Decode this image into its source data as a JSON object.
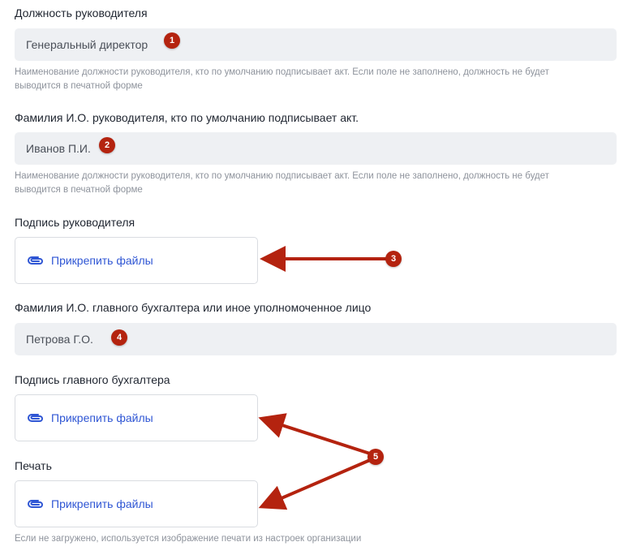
{
  "colors": {
    "annotation": "#b4230f",
    "link": "#2f56d4",
    "field_bg": "#eef0f3",
    "hint": "#8e939c"
  },
  "fields": {
    "position": {
      "label": "Должность руководителя",
      "value": "Генеральный директор",
      "hint_line1": "Наименование должности руководителя, кто по умолчанию подписывает акт. Если поле не заполнено, должность не будет",
      "hint_line2": "выводится в печатной форме"
    },
    "director_name": {
      "label": "Фамилия И.О. руководителя, кто по умолчанию подписывает акт.",
      "value": "Иванов П.И.",
      "hint_line1": "Наименование должности руководителя, кто по умолчанию подписывает акт. Если поле не заполнено, должность не будет",
      "hint_line2": "выводится в печатной форме"
    },
    "director_signature": {
      "label": "Подпись руководителя",
      "attach_label": "Прикрепить файлы"
    },
    "accountant_name": {
      "label": "Фамилия И.О. главного бухгалтера или иное уполномоченное лицо",
      "value": "Петрова Г.О."
    },
    "accountant_signature": {
      "label": "Подпись главного бухгалтера",
      "attach_label": "Прикрепить файлы"
    },
    "stamp": {
      "label": "Печать",
      "attach_label": "Прикрепить файлы",
      "hint": "Если не загружено, используется изображение печати из настроек организации"
    }
  },
  "annotations": {
    "badge_1": "1",
    "badge_2": "2",
    "badge_3": "3",
    "badge_4": "4",
    "badge_5": "5"
  }
}
